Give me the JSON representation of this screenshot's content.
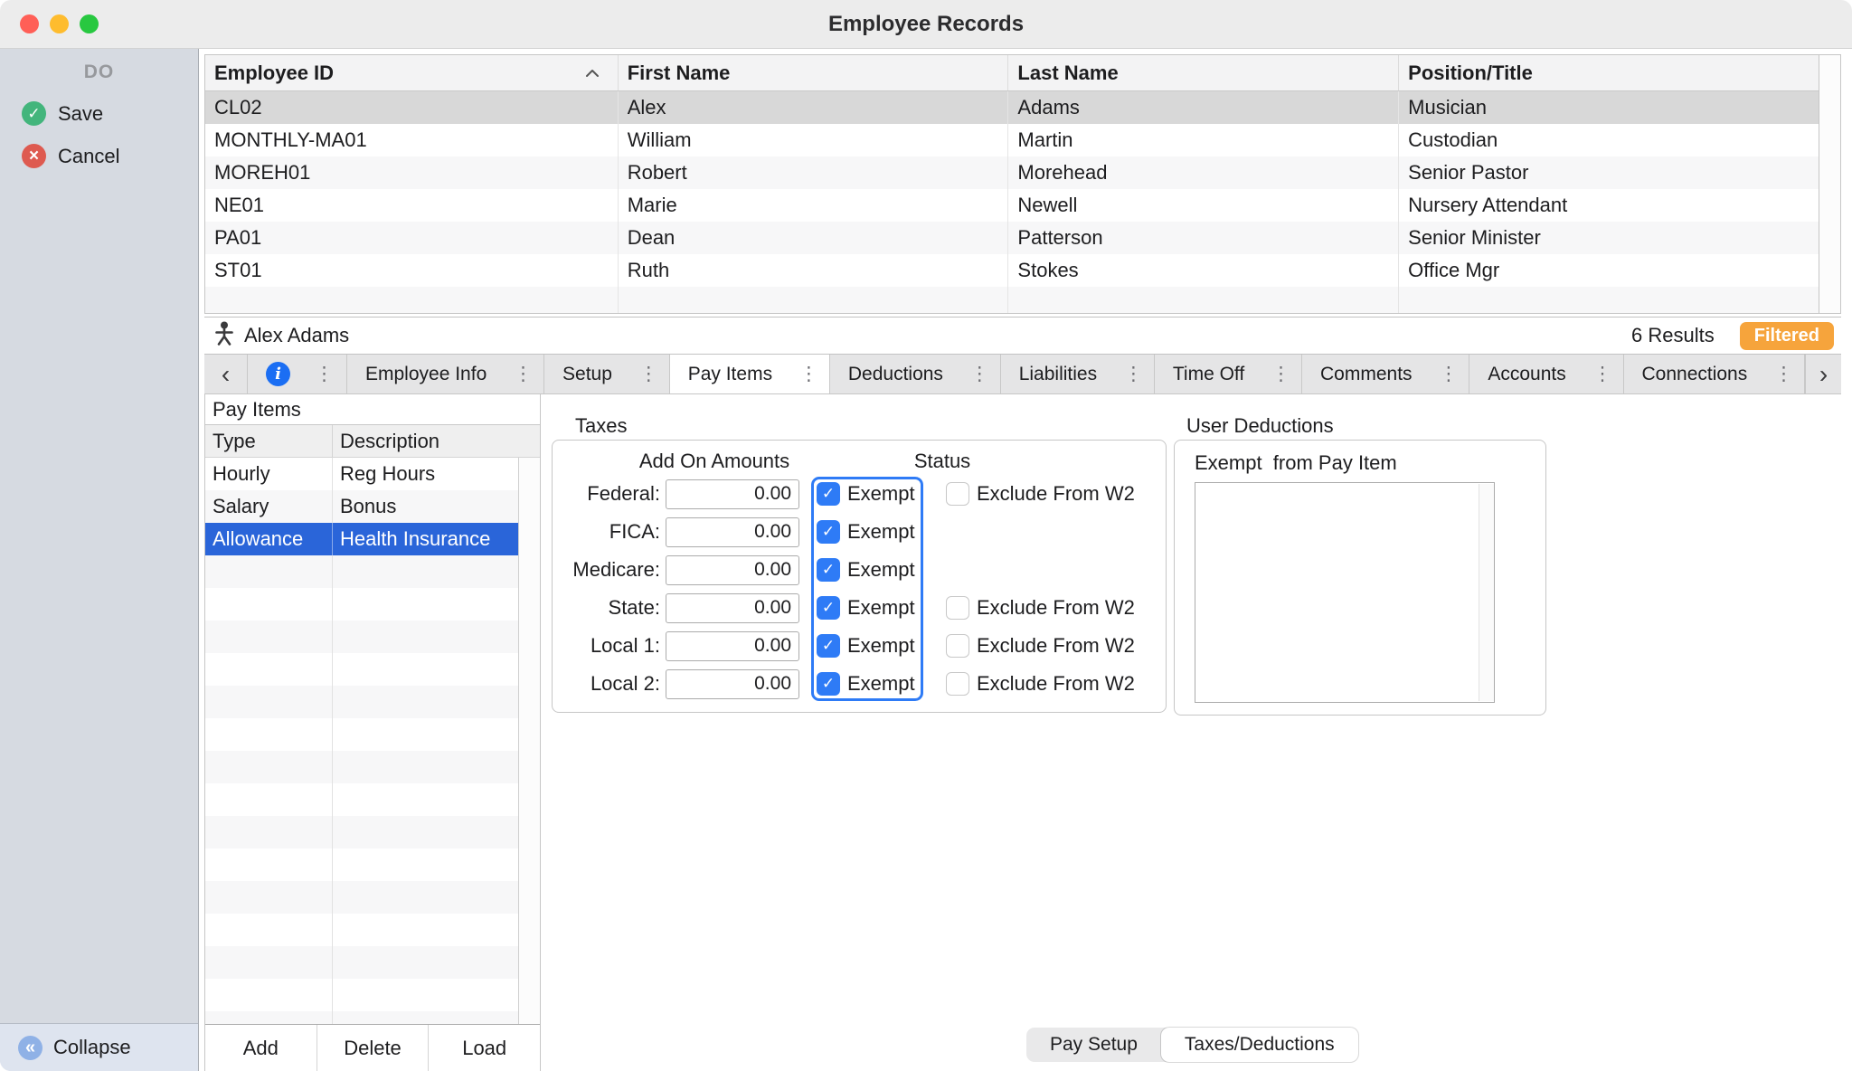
{
  "window": {
    "title": "Employee Records"
  },
  "glyphs": {
    "check": "✓",
    "cross": "×",
    "collapse": "«",
    "kebab": "⋮",
    "nav_left": "‹",
    "nav_right": "›",
    "info": "i"
  },
  "sidebar": {
    "header": "DO",
    "save_label": "Save",
    "cancel_label": "Cancel",
    "collapse_label": "Collapse"
  },
  "employee_table": {
    "columns": [
      "Employee ID",
      "First Name",
      "Last Name",
      "Position/Title"
    ],
    "sorted_column": "Employee ID",
    "sort_direction": "ascending",
    "rows": [
      {
        "id": "CL02",
        "first": "Alex",
        "last": "Adams",
        "position": "Musician",
        "selected": true
      },
      {
        "id": "MONTHLY-MA01",
        "first": "William",
        "last": "Martin",
        "position": "Custodian",
        "selected": false
      },
      {
        "id": "MOREH01",
        "first": "Robert",
        "last": "Morehead",
        "position": "Senior Pastor",
        "selected": false
      },
      {
        "id": "NE01",
        "first": "Marie",
        "last": "Newell",
        "position": "Nursery Attendant",
        "selected": false
      },
      {
        "id": "PA01",
        "first": "Dean",
        "last": "Patterson",
        "position": "Senior Minister",
        "selected": false
      },
      {
        "id": "ST01",
        "first": "Ruth",
        "last": "Stokes",
        "position": "Office Mgr",
        "selected": false
      }
    ]
  },
  "record_bar": {
    "employee_name": "Alex Adams",
    "results_text": "6 Results",
    "filtered_label": "Filtered"
  },
  "tabs": {
    "items": [
      "Employee Info",
      "Setup",
      "Pay Items",
      "Deductions",
      "Liabilities",
      "Time Off",
      "Comments",
      "Accounts",
      "Connections"
    ],
    "active": "Pay Items"
  },
  "pay_items": {
    "panel_title": "Pay Items",
    "columns": [
      "Type",
      "Description"
    ],
    "rows": [
      {
        "type": "Hourly",
        "description": "Reg Hours",
        "selected": false
      },
      {
        "type": "Salary",
        "description": "Bonus",
        "selected": false
      },
      {
        "type": "Allowance",
        "description": "Health Insurance",
        "selected": true
      }
    ],
    "buttons": [
      "Add",
      "Delete",
      "Load"
    ]
  },
  "taxes": {
    "title": "Taxes",
    "amounts_header": "Add On Amounts",
    "status_header": "Status",
    "exempt_label": "Exempt",
    "exclude_label": "Exclude From W2",
    "rows": [
      {
        "label": "Federal:",
        "amount": "0.00",
        "exempt": true,
        "exclude_visible": true,
        "exclude": false
      },
      {
        "label": "FICA:",
        "amount": "0.00",
        "exempt": true,
        "exclude_visible": false,
        "exclude": false
      },
      {
        "label": "Medicare:",
        "amount": "0.00",
        "exempt": true,
        "exclude_visible": false,
        "exclude": false
      },
      {
        "label": "State:",
        "amount": "0.00",
        "exempt": true,
        "exclude_visible": true,
        "exclude": false
      },
      {
        "label": "Local 1:",
        "amount": "0.00",
        "exempt": true,
        "exclude_visible": true,
        "exclude": false
      },
      {
        "label": "Local 2:",
        "amount": "0.00",
        "exempt": true,
        "exclude_visible": true,
        "exclude": false
      }
    ]
  },
  "user_deductions": {
    "title": "User Deductions",
    "list_label": "Exempt  from Pay Item",
    "items": []
  },
  "bottom_tabs": {
    "items": [
      "Pay Setup",
      "Taxes/Deductions"
    ],
    "active": "Taxes/Deductions"
  },
  "colors": {
    "accent_blue": "#2E7BF6",
    "selection_blue": "#2A65D9",
    "filtered_orange": "#F6A43C",
    "save_green": "#43B57C",
    "cancel_red": "#DE5A50"
  }
}
